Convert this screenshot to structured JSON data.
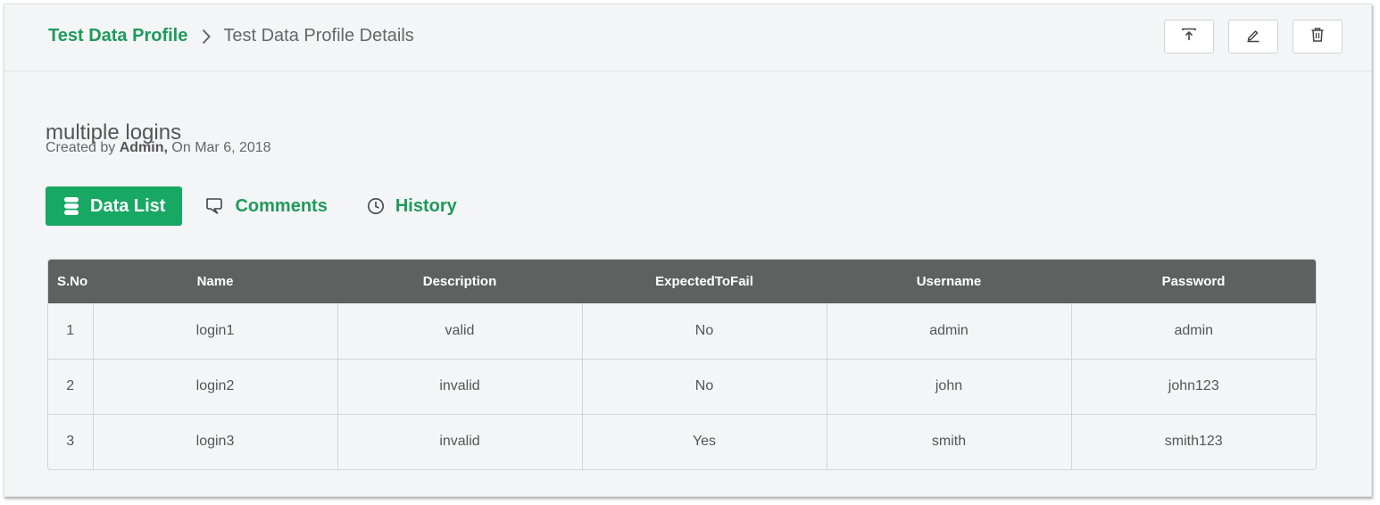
{
  "breadcrumb": {
    "root": "Test Data Profile",
    "current": "Test Data Profile Details"
  },
  "actions": [
    {
      "name": "export-button",
      "icon": "upload-icon"
    },
    {
      "name": "edit-button",
      "icon": "pencil-icon"
    },
    {
      "name": "delete-button",
      "icon": "trash-icon"
    }
  ],
  "profile": {
    "title": "multiple logins",
    "created_by_label": "Created by",
    "author": "Admin,",
    "on_label": "On",
    "date": "Mar 6, 2018"
  },
  "tabs": {
    "data_list": "Data List",
    "comments": "Comments",
    "history": "History"
  },
  "table": {
    "columns": [
      "S.No",
      "Name",
      "Description",
      "ExpectedToFail",
      "Username",
      "Password"
    ],
    "rows": [
      [
        "1",
        "login1",
        "valid",
        "No",
        "admin",
        "admin"
      ],
      [
        "2",
        "login2",
        "invalid",
        "No",
        "john",
        "john123"
      ],
      [
        "3",
        "login3",
        "invalid",
        "Yes",
        "smith",
        "smith123"
      ]
    ]
  },
  "colors": {
    "accent": "#1f9a5b",
    "active_tab": "#17a863",
    "table_header": "#5f6160",
    "background": "#f4f5f7"
  }
}
